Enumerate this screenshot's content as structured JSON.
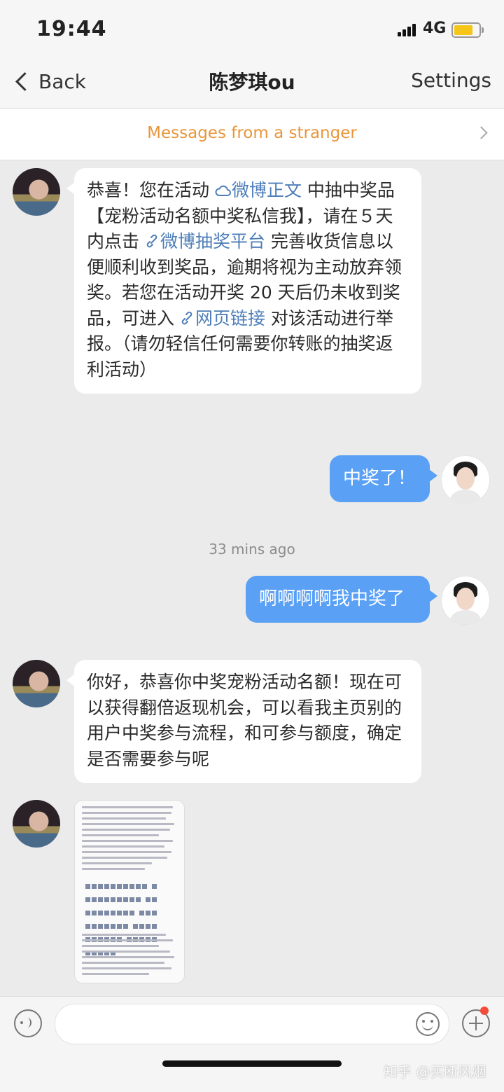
{
  "status": {
    "time": "19:44",
    "network": "4G"
  },
  "nav": {
    "back_label": "Back",
    "title": "陈梦琪ou",
    "settings_label": "Settings"
  },
  "banner": {
    "text": "Messages from a stranger"
  },
  "messages": [
    {
      "side": "left",
      "parts": {
        "p1": "恭喜！您在活动 ",
        "l1": "微博正文",
        "p2": " 中抽中奖品【宠粉活动名额中奖私信我】，请在５天内点击 ",
        "l2": "微博抽奖平台",
        "p3": " 完善收货信息以便顺利收到奖品，逾期将视为主动放弃领奖。若您在活动开奖 20 天后仍未收到奖品，可进入 ",
        "l3": "网页链接",
        "p4": " 对该活动进行举报。（请勿轻信任何需要你转账的抽奖返利活动）"
      }
    },
    {
      "side": "right",
      "text": "中奖了！"
    },
    {
      "side": "right",
      "text": "啊啊啊啊我中奖了"
    },
    {
      "side": "left",
      "text": "你好，恭喜你中奖宠粉活动名额！现在可以获得翻倍返现机会，可以看我主页别的用户中奖参与流程，和可参与额度，确定是否需要参与呢"
    },
    {
      "side": "left",
      "type": "image"
    }
  ],
  "timestamp": "33 mins ago",
  "watermark": "知乎 @买断风烟",
  "icons": [
    "voice-icon",
    "emoji-icon",
    "plus-icon",
    "cloud-icon",
    "link-icon"
  ],
  "colors": {
    "accent_orange": "#e8963a",
    "bubble_blue": "#5aa0f5",
    "link_blue": "#4d7eb8",
    "badge_red": "#f24d3a"
  }
}
